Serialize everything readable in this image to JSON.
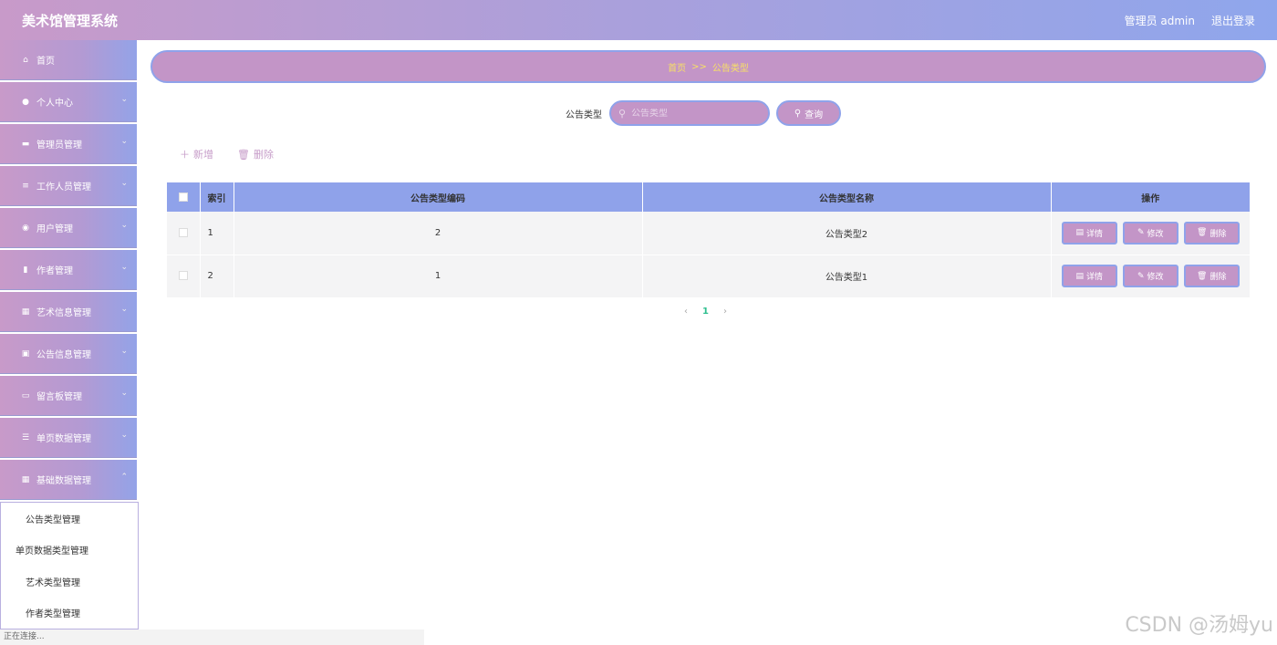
{
  "header": {
    "title": "美术馆管理系统",
    "user": "管理员 admin",
    "logout": "退出登录"
  },
  "sidebar": {
    "items": [
      {
        "label": "首页",
        "icon": "home-icon",
        "glyph": "⌂",
        "has_chevron": false
      },
      {
        "label": "个人中心",
        "icon": "user-icon",
        "glyph": "●",
        "has_chevron": true
      },
      {
        "label": "管理员管理",
        "icon": "admin-icon",
        "glyph": "▬",
        "has_chevron": true
      },
      {
        "label": "工作人员管理",
        "icon": "list-icon",
        "glyph": "≡",
        "has_chevron": true
      },
      {
        "label": "用户管理",
        "icon": "location-icon",
        "glyph": "◉",
        "has_chevron": true
      },
      {
        "label": "作者管理",
        "icon": "chart-icon",
        "glyph": "▮",
        "has_chevron": true
      },
      {
        "label": "艺术信息管理",
        "icon": "grid-icon",
        "glyph": "▦",
        "has_chevron": true
      },
      {
        "label": "公告信息管理",
        "icon": "clipboard-icon",
        "glyph": "▣",
        "has_chevron": true
      },
      {
        "label": "留言板管理",
        "icon": "briefcase-icon",
        "glyph": "▭",
        "has_chevron": true
      },
      {
        "label": "单页数据管理",
        "icon": "sliders-icon",
        "glyph": "☰",
        "has_chevron": true
      },
      {
        "label": "基础数据管理",
        "icon": "grid-icon",
        "glyph": "▦",
        "has_chevron": true
      }
    ],
    "submenu": [
      "公告类型管理",
      "单页数据类型管理",
      "艺术类型管理",
      "作者类型管理"
    ],
    "status": "正在连接..."
  },
  "breadcrumb": {
    "home": "首页",
    "separator": ">>",
    "current": "公告类型"
  },
  "search": {
    "label": "公告类型",
    "placeholder": "公告类型",
    "button": "查询"
  },
  "toolbar": {
    "add": "新增",
    "delete": "删除"
  },
  "table": {
    "columns": [
      "索引",
      "公告类型编码",
      "公告类型名称",
      "操作"
    ],
    "rows": [
      {
        "index": "1",
        "code": "2",
        "name": "公告类型2"
      },
      {
        "index": "2",
        "code": "1",
        "name": "公告类型1"
      }
    ],
    "actions": {
      "detail": "详情",
      "edit": "修改",
      "delete": "删除"
    }
  },
  "pagination": {
    "prev": "‹",
    "current": "1",
    "next": "›"
  },
  "watermark": "CSDN @汤姆yu",
  "colors": {
    "accent_pink": "#c395c7",
    "accent_blue": "#8fa2ea",
    "breadcrumb_text": "#f7e066"
  }
}
